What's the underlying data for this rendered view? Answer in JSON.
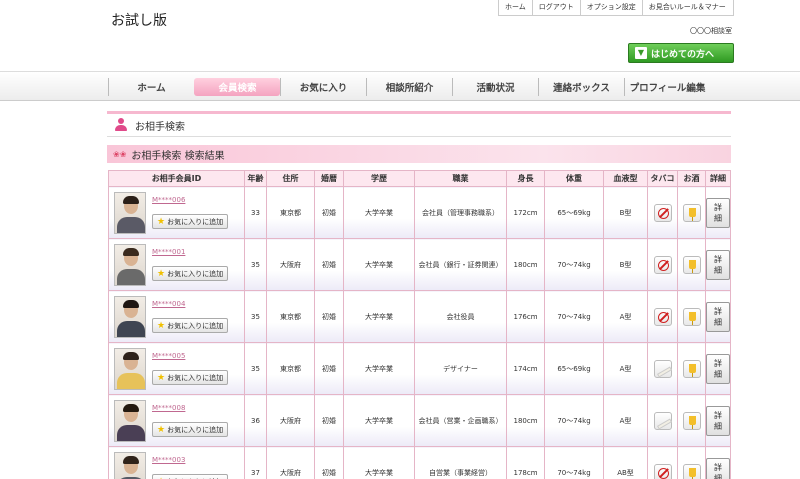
{
  "header": {
    "site_title": "お試し版",
    "top_links": [
      "ホーム",
      "ログアウト",
      "オプション設定",
      "お見合いルール＆マナー"
    ],
    "office_name": "〇〇〇相談室",
    "first_time_button": "はじめての方へ"
  },
  "nav": {
    "items": [
      "ホーム",
      "会員検索",
      "お気に入り",
      "相談所紹介",
      "活動状況",
      "連絡ボックス",
      "プロフィール編集"
    ],
    "active_index": 1
  },
  "search_section": {
    "title": "お相手検索"
  },
  "results": {
    "title": "お相手検索 検索結果",
    "columns": [
      "お相手会員ID",
      "年齢",
      "住所",
      "婚暦",
      "学歴",
      "職業",
      "身長",
      "体重",
      "血液型",
      "タバコ",
      "お酒",
      "詳細"
    ],
    "favorite_label": "お気に入りに追加",
    "detail_label": "詳細",
    "rows": [
      {
        "id": "M****006",
        "age": "33",
        "address": "東京都",
        "marital": "初婚",
        "education": "大学卒業",
        "job": "会社員（管理事務職系）",
        "height": "172cm",
        "weight": "65～69kg",
        "blood": "B型",
        "smoke": "no",
        "drink": "yes"
      },
      {
        "id": "M****001",
        "age": "35",
        "address": "大阪府",
        "marital": "初婚",
        "education": "大学卒業",
        "job": "会社員（銀行・証券関連）",
        "height": "180cm",
        "weight": "70～74kg",
        "blood": "B型",
        "smoke": "no",
        "drink": "yes"
      },
      {
        "id": "M****004",
        "age": "35",
        "address": "東京都",
        "marital": "初婚",
        "education": "大学卒業",
        "job": "会社役員",
        "height": "176cm",
        "weight": "70～74kg",
        "blood": "A型",
        "smoke": "no",
        "drink": "yes"
      },
      {
        "id": "M****005",
        "age": "35",
        "address": "東京都",
        "marital": "初婚",
        "education": "大学卒業",
        "job": "デザイナー",
        "height": "174cm",
        "weight": "65～69kg",
        "blood": "A型",
        "smoke": "yes",
        "drink": "yes"
      },
      {
        "id": "M****008",
        "age": "36",
        "address": "大阪府",
        "marital": "初婚",
        "education": "大学卒業",
        "job": "会社員（営業・企画職系）",
        "height": "180cm",
        "weight": "70～74kg",
        "blood": "A型",
        "smoke": "yes",
        "drink": "yes"
      },
      {
        "id": "M****003",
        "age": "37",
        "address": "大阪府",
        "marital": "初婚",
        "education": "大学卒業",
        "job": "自営業（事業経営）",
        "height": "178cm",
        "weight": "70～74kg",
        "blood": "AB型",
        "smoke": "no",
        "drink": "yes"
      }
    ]
  },
  "colors": {
    "accent_pink": "#f4a3c0",
    "green_button": "#2f9a22",
    "header_bg": "#fde7ef"
  }
}
